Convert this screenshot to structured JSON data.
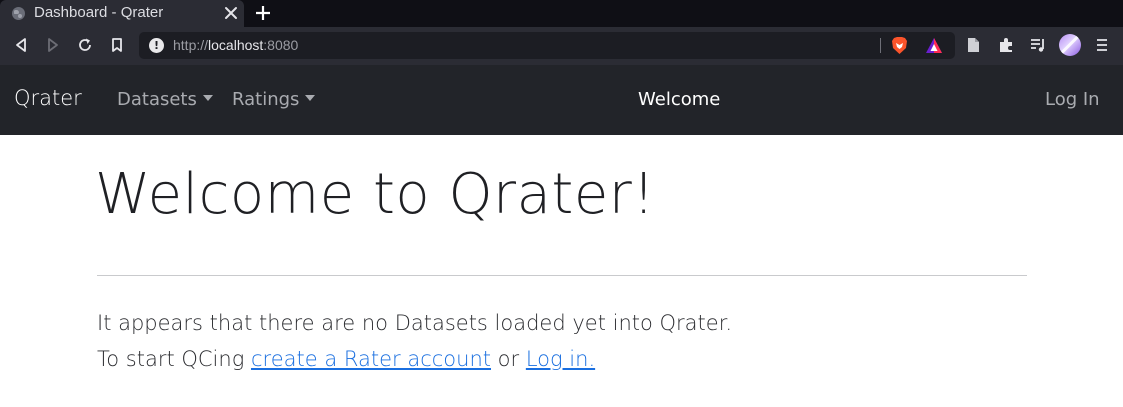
{
  "browser": {
    "tab": {
      "title": "Dashboard - Qrater"
    },
    "address": {
      "scheme": "http://",
      "host": "localhost",
      "port": ":8080"
    }
  },
  "icons": {
    "back": "back-arrow-icon",
    "forward": "forward-arrow-icon",
    "reload": "reload-icon",
    "bookmark": "bookmark-icon",
    "site_info": "info-icon",
    "brave_shield": "brave-lion-icon",
    "rewards": "brave-rewards-icon",
    "reader": "reader-mode-icon",
    "extensions": "puzzle-icon",
    "media": "playlist-icon",
    "profile": "profile-avatar-icon",
    "menu": "hamburger-menu-icon"
  },
  "colors": {
    "navbar_bg": "#222429",
    "link": "#1a6fe0",
    "chrome_bg": "#2b2c34"
  },
  "navbar": {
    "brand": "Qrater",
    "datasets": "Datasets",
    "ratings": "Ratings",
    "center": "Welcome",
    "login": "Log In"
  },
  "main": {
    "title": "Welcome to Qrater!",
    "line1": "It appears that there are no Datasets loaded yet into Qrater.",
    "line2_prefix": "To start QCing ",
    "create_account_link": "create a Rater account",
    "line2_middle": " or ",
    "login_link": "Log in."
  }
}
